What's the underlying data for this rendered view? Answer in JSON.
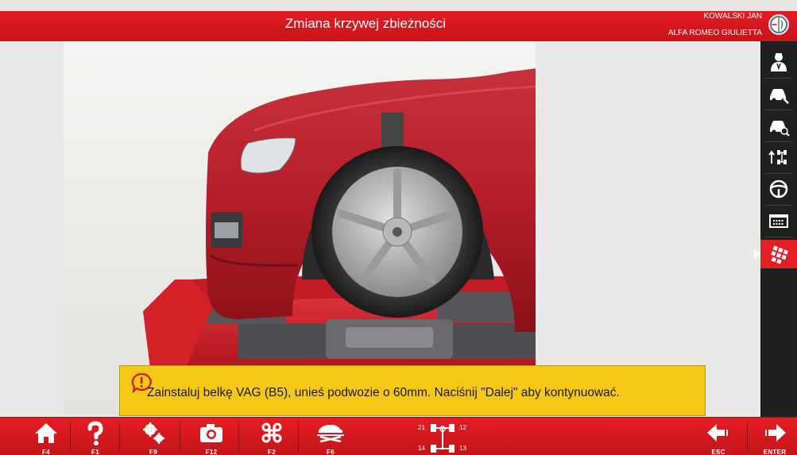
{
  "header": {
    "title": "Zmiana krzywej zbieżności",
    "user": "KOWALSKI JAN",
    "vehicle": "ALFA ROMEO GIULIETTA"
  },
  "message": {
    "text": "Zainstaluj belkę VAG (B5), unieś podwozie o 60mm. Naciśnij \"Dalej\" aby kontynuować."
  },
  "sidebar": {
    "items": [
      {
        "icon": "technician-icon"
      },
      {
        "icon": "car-tools-icon"
      },
      {
        "icon": "car-search-icon"
      },
      {
        "icon": "axle-adjust-icon"
      },
      {
        "icon": "steering-wheel-icon"
      },
      {
        "icon": "keyboard-icon"
      },
      {
        "icon": "calibration-grid-icon",
        "active": true
      }
    ]
  },
  "toolbar": {
    "home_key": "F4",
    "help_key": "F1",
    "settings_key": "F9",
    "camera_key": "F12",
    "menu_key": "F2",
    "lift_key": "F6",
    "back_key": "ESC",
    "next_key": "ENTER",
    "axle": {
      "fl": "21",
      "fr": "12",
      "rl": "14",
      "rr": "13"
    }
  },
  "colors": {
    "accent": "#d8181f",
    "message_bg": "#f5c816",
    "sidebar_bg": "#1f1f1f"
  }
}
